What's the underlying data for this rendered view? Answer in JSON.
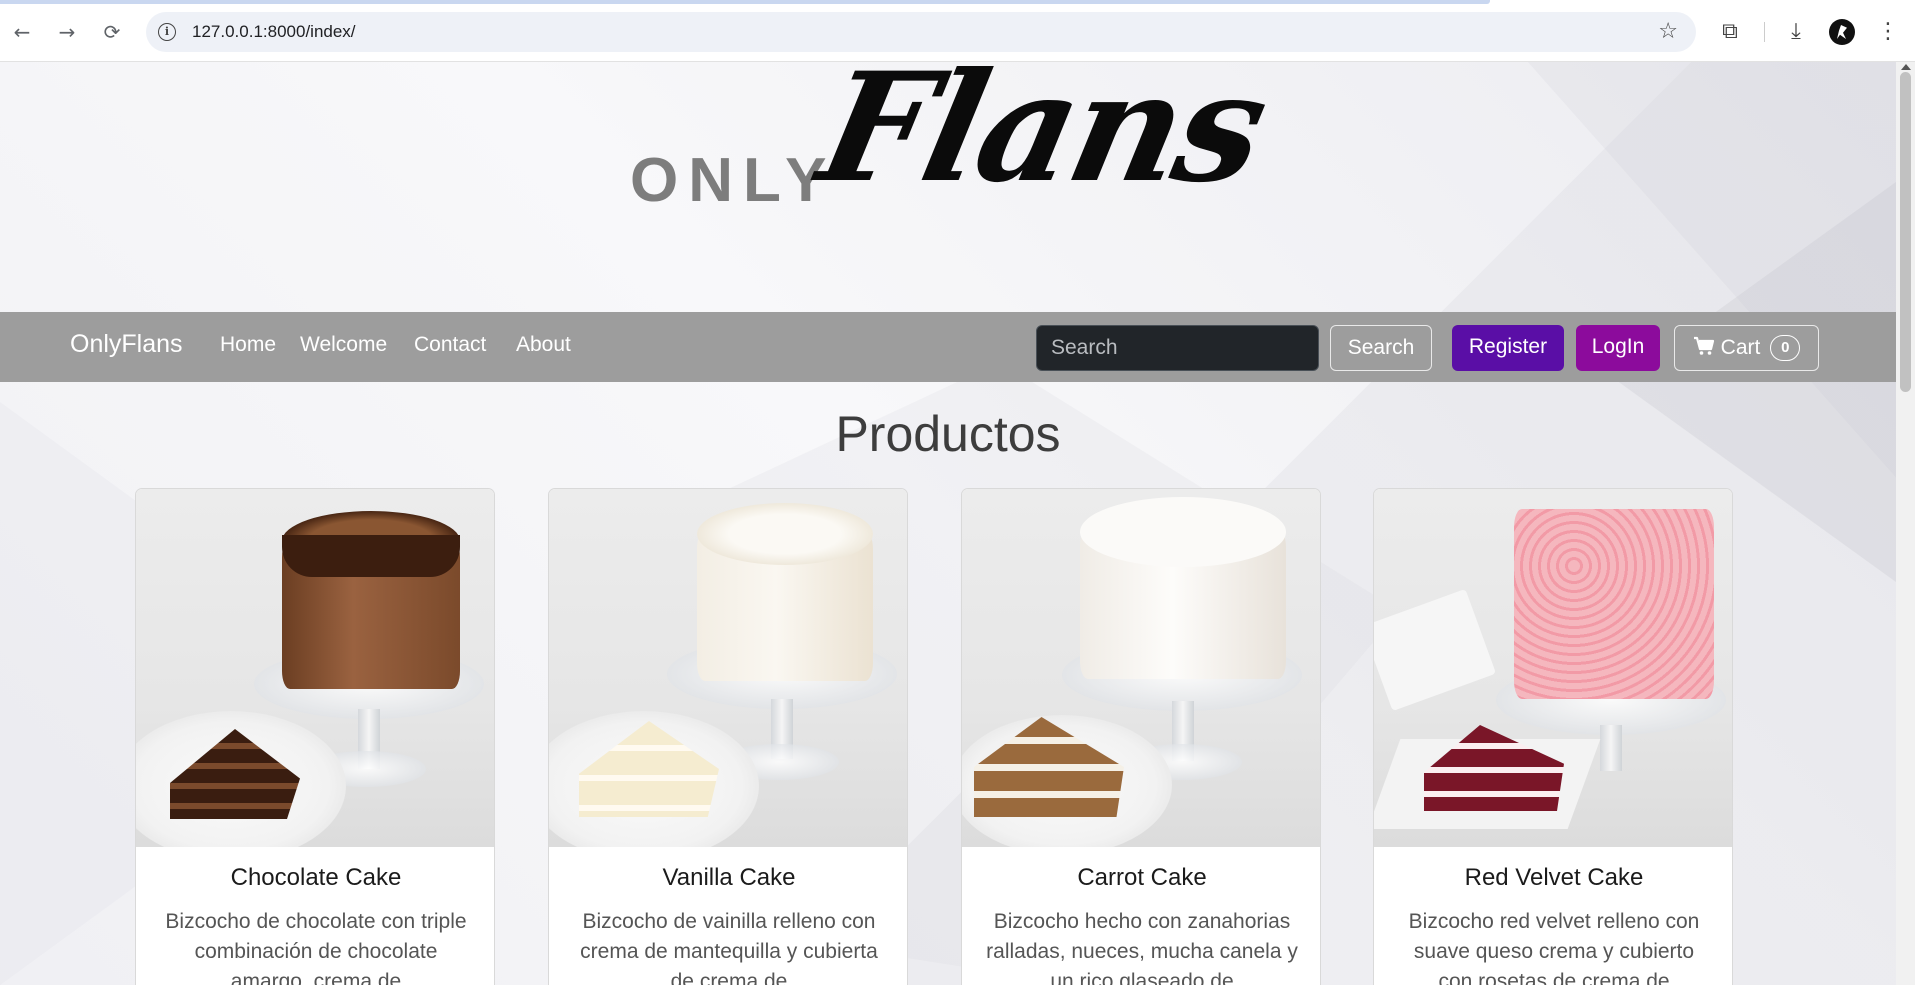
{
  "browser": {
    "url": "127.0.0.1:8000/index/",
    "icons": [
      "back-icon",
      "forward-icon",
      "reload-icon",
      "site-info-icon",
      "bookmark-star-icon",
      "extensions-icon",
      "download-icon",
      "profile-avatar",
      "menu-icon"
    ]
  },
  "logo": {
    "only": "ONLY",
    "flans": "Flans"
  },
  "navbar": {
    "brand": "OnlyFlans",
    "links": [
      "Home",
      "Welcome",
      "Contact",
      "About"
    ],
    "search_placeholder": "Search",
    "search_button": "Search",
    "register": "Register",
    "login": "LogIn",
    "cart_label": "Cart",
    "cart_count": "0"
  },
  "section_title": "Productos",
  "products": [
    {
      "name": "Chocolate Cake",
      "description": "Bizcocho de chocolate con triple combinación de chocolate amargo, crema de"
    },
    {
      "name": "Vanilla Cake",
      "description": "Bizcocho de vainilla relleno con crema de mantequilla y cubierta de crema de"
    },
    {
      "name": "Carrot Cake",
      "description": "Bizcocho hecho con zanahorias ralladas, nueces, mucha canela y un rico glaseado de"
    },
    {
      "name": "Red Velvet Cake",
      "description": "Bizcocho red velvet relleno con suave queso crema y cubierto con rosetas de crema de"
    }
  ],
  "colors": {
    "navbar": "#9d9d9d",
    "register": "#5a0ea6",
    "login": "#8c0b9c",
    "search_field": "#212529"
  }
}
